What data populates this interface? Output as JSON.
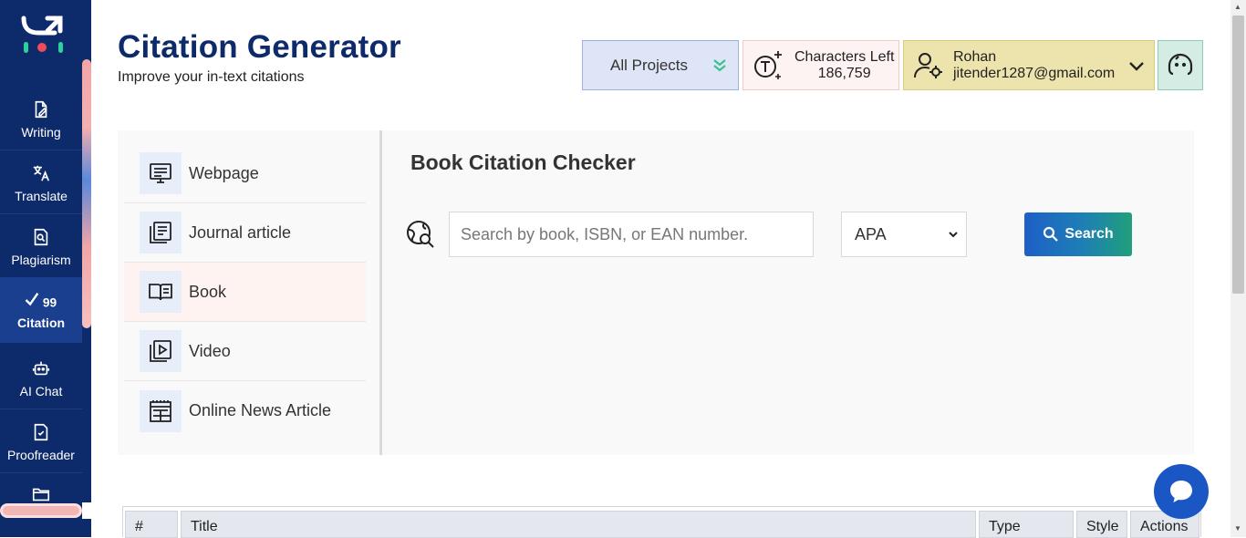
{
  "sidebar": {
    "items": [
      {
        "label": "Writing",
        "icon": "writing-icon"
      },
      {
        "label": "Translate",
        "icon": "translate-icon"
      },
      {
        "label": "Plagiarism",
        "icon": "plagiarism-icon"
      },
      {
        "label": "Citation",
        "icon": "citation-icon",
        "active": true
      },
      {
        "label": "AI Chat",
        "icon": "robot-icon"
      },
      {
        "label": "Proofreader",
        "icon": "proofreader-icon"
      },
      {
        "label": "",
        "icon": "folder-icon"
      }
    ]
  },
  "header": {
    "title": "Citation Generator",
    "subtitle": "Improve your in-text citations",
    "projects_label": "All Projects",
    "chars_label": "Characters Left",
    "chars_value": "186,759",
    "user_name": "Rohan",
    "user_email": "jitender1287@gmail.com"
  },
  "source_types": [
    {
      "label": "Webpage",
      "icon": "webpage-icon"
    },
    {
      "label": "Journal article",
      "icon": "journal-icon"
    },
    {
      "label": "Book",
      "icon": "book-icon",
      "active": true
    },
    {
      "label": "Video",
      "icon": "video-icon"
    },
    {
      "label": "Online News Article",
      "icon": "news-icon"
    }
  ],
  "checker": {
    "title": "Book Citation Checker",
    "search_placeholder": "Search by book, ISBN, or EAN number.",
    "style_value": "APA",
    "search_button": "Search"
  },
  "table": {
    "headers": [
      "#",
      "Title",
      "Type",
      "Style",
      "Actions"
    ]
  },
  "colors": {
    "sidebar": "#0d2a6b",
    "title": "#0d2a6b",
    "accent_blue": "#1d5fc7",
    "accent_green": "#20a07a"
  }
}
